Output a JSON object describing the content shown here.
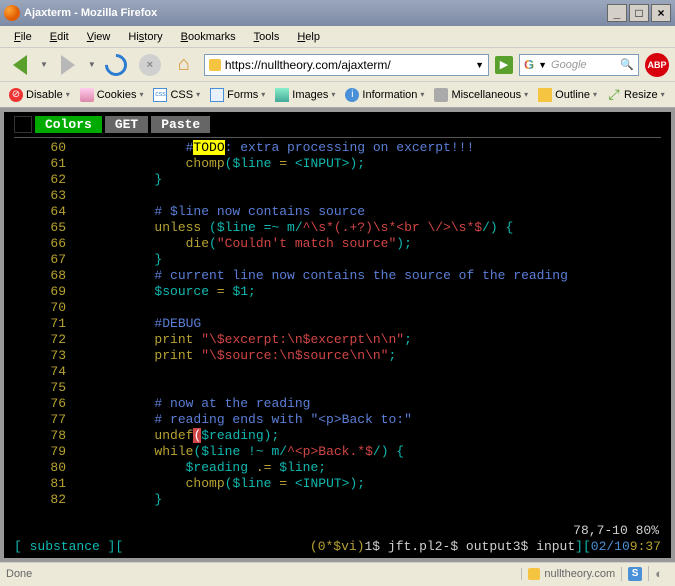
{
  "window": {
    "title": "Ajaxterm - Mozilla Firefox"
  },
  "menu": {
    "file": "File",
    "edit": "Edit",
    "view": "View",
    "history": "History",
    "bookmarks": "Bookmarks",
    "tools": "Tools",
    "help": "Help"
  },
  "nav": {
    "url": "https://nulltheory.com/ajaxterm/",
    "search_placeholder": "Google"
  },
  "dev": {
    "disable": "Disable",
    "cookies": "Cookies",
    "css": "CSS",
    "forms": "Forms",
    "images": "Images",
    "information": "Information",
    "miscellaneous": "Miscellaneous",
    "outline": "Outline",
    "resize": "Resize"
  },
  "term_tabs": {
    "colors": "Colors",
    "get": "GET",
    "paste": "Paste"
  },
  "code": {
    "l60n": "60",
    "l60_todo": "TODO",
    "l60_c": ": extra processing on excerpt!!!",
    "l61n": "61",
    "l61": "            chomp($line = <INPUT>);",
    "l62n": "62",
    "l62": "        }",
    "l63n": "63",
    "l64n": "64",
    "l64": "# $line now contains source",
    "l65n": "65",
    "l65a": "unless",
    "l65b": " ($line =~ m/",
    "l65c": "^\\s*(.+?)\\s*<br \\/>\\s*$",
    "l65d": "/) {",
    "l66n": "66",
    "l66a": "die",
    "l66b": "(",
    "l66c": "\"Couldn't match source\"",
    "l66d": ");",
    "l67n": "67",
    "l67": "}",
    "l68n": "68",
    "l68": "# current line now contains the source of the reading",
    "l69n": "69",
    "l69a": "$source",
    "l69b": " = ",
    "l69c": "$1",
    "l69d": ";",
    "l70n": "70",
    "l71n": "71",
    "l71": "#DEBUG",
    "l72n": "72",
    "l72a": "print",
    "l72b": " ",
    "l72c": "\"\\$excerpt:\\n$excerpt\\n\\n\"",
    "l72d": ";",
    "l73n": "73",
    "l73a": "print",
    "l73b": " ",
    "l73c": "\"\\$source:\\n$source\\n\\n\"",
    "l73d": ";",
    "l74n": "74",
    "l75n": "75",
    "l76n": "76",
    "l76": "# now at the reading",
    "l77n": "77",
    "l77": "# reading ends with \"<p>Back to:\"",
    "l78n": "78",
    "l78a": "undef",
    "l78p": "(",
    "l78b": "$reading",
    "l78c": ");",
    "l79n": "79",
    "l79a": "while",
    "l79b": "($line !~ m/",
    "l79c": "^<p>Back.*$",
    "l79d": "/) {",
    "l80n": "80",
    "l80a": "$reading",
    "l80b": " .= ",
    "l80c": "$line",
    "l80d": ";",
    "l81n": "81",
    "l81": "chomp($line = <INPUT>);",
    "l82n": "82",
    "l82": "}"
  },
  "vim": {
    "pos": "78,7-10",
    "pct": "80%"
  },
  "screen": {
    "left": "[ substance ][",
    "vi": "(0*$vi)",
    "w1": "1$ jft.pl",
    "w2": "2-$ output",
    "w3": "3$ input",
    "br": "][",
    "date": "02/10",
    "time": "9:37"
  },
  "status": {
    "done": "Done",
    "host": "nulltheory.com"
  }
}
